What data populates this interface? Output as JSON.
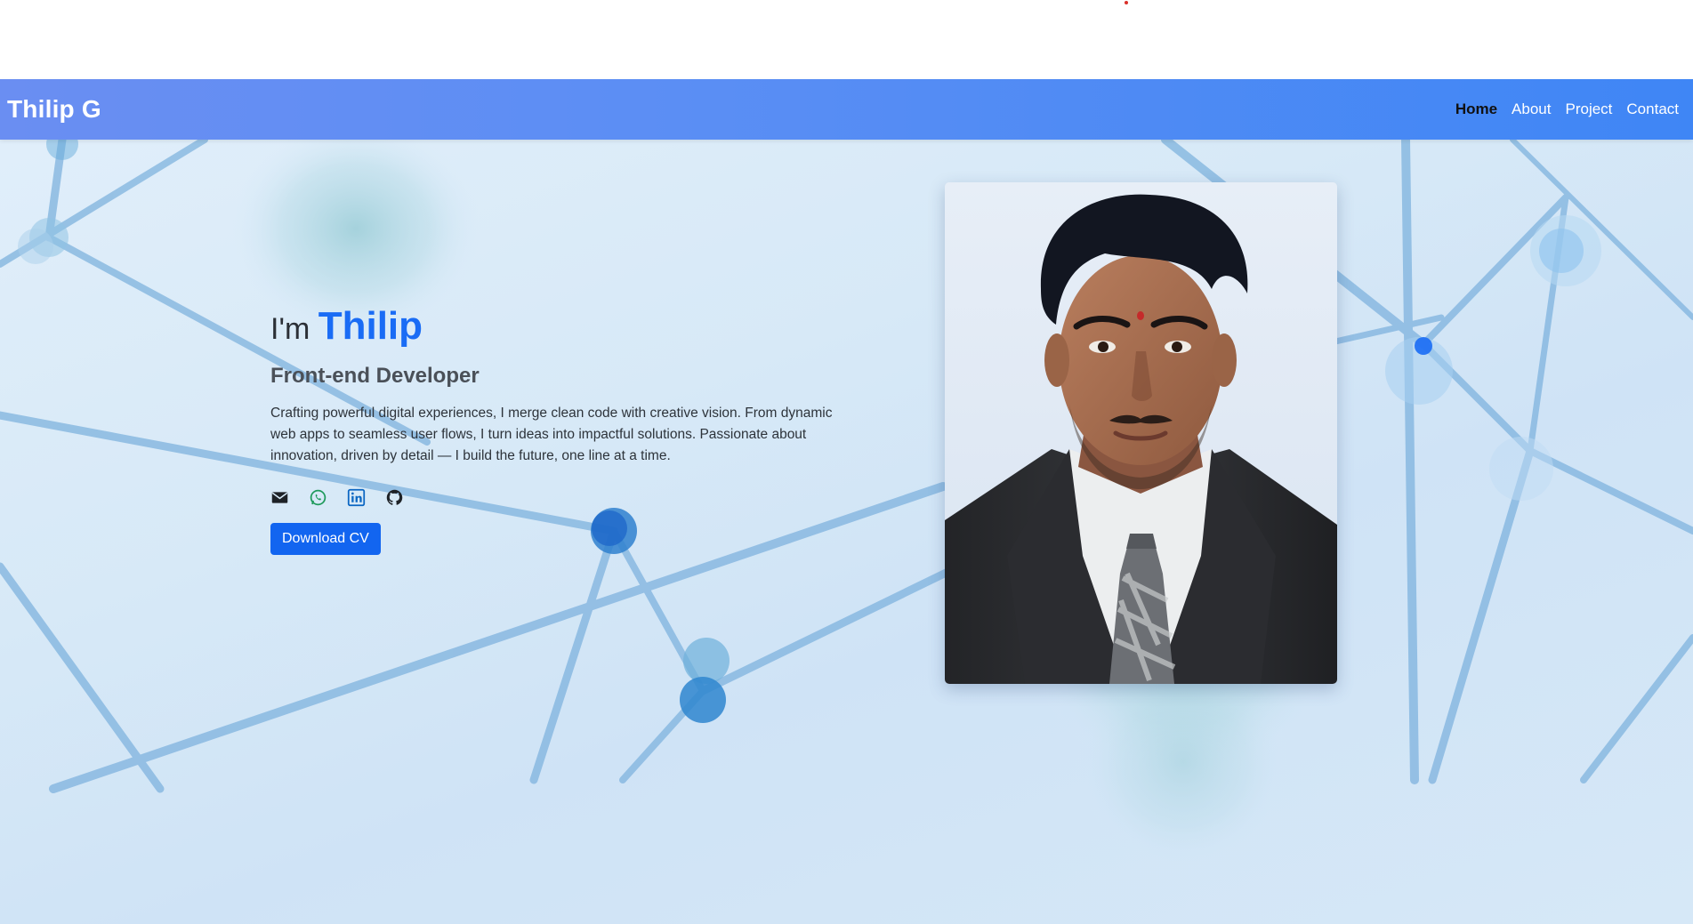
{
  "navbar": {
    "brand": "Thilip G",
    "links": [
      {
        "label": "Home",
        "active": true
      },
      {
        "label": "About",
        "active": false
      },
      {
        "label": "Project",
        "active": false
      },
      {
        "label": "Contact",
        "active": false
      }
    ]
  },
  "hero": {
    "greeting_prefix": "I'm",
    "name": "Thilip",
    "role": "Front-end Developer",
    "bio": "Crafting powerful digital experiences, I merge clean code with creative vision. From dynamic web apps to seamless user flows, I turn ideas into impactful solutions. Passionate about innovation, driven by detail — I build the future, one line at a time.",
    "socials": [
      {
        "icon": "envelope-icon",
        "color": "#1e2227"
      },
      {
        "icon": "whatsapp-icon",
        "color": "#1e9a5b"
      },
      {
        "icon": "linkedin-icon",
        "color": "#0a66c2"
      },
      {
        "icon": "github-icon",
        "color": "#1e2227"
      }
    ],
    "cv_button": "Download CV"
  },
  "colors": {
    "accent": "#1a6cf5",
    "button": "#1265f0",
    "navbar_start": "#6a8ef2",
    "navbar_end": "#3f86f5"
  }
}
